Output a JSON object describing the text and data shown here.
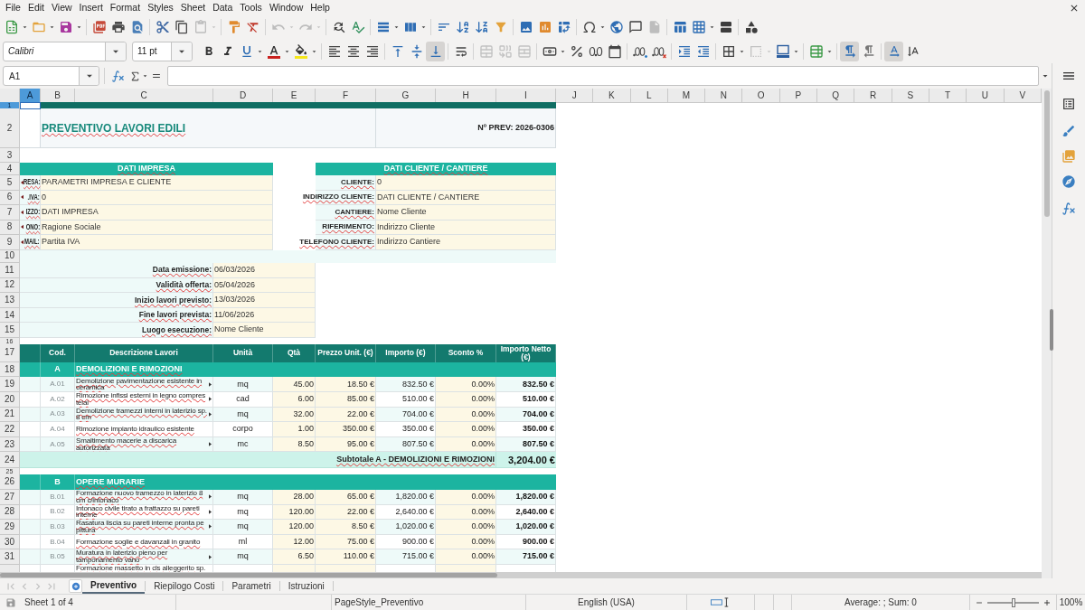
{
  "menu": [
    "File",
    "Edit",
    "View",
    "Insert",
    "Format",
    "Styles",
    "Sheet",
    "Data",
    "Tools",
    "Window",
    "Help"
  ],
  "standard_toolbar": [
    {
      "kind": "new",
      "disabled": false
    },
    {
      "kind": "open",
      "disabled": false
    },
    {
      "kind": "save",
      "disabled": false
    },
    {
      "kind": "export_pdf",
      "disabled": false
    },
    {
      "kind": "print",
      "disabled": false
    },
    {
      "kind": "print_preview",
      "disabled": false
    },
    {
      "kind": "cut",
      "disabled": false
    },
    {
      "kind": "copy",
      "disabled": false
    },
    {
      "kind": "paste",
      "disabled": true
    },
    {
      "kind": "clone_formatting",
      "disabled": false
    },
    {
      "kind": "clear_formatting",
      "disabled": false
    },
    {
      "kind": "undo",
      "disabled": true
    },
    {
      "kind": "redo",
      "disabled": true
    },
    {
      "kind": "find_replace",
      "disabled": false
    },
    {
      "kind": "spelling",
      "disabled": false
    },
    {
      "kind": "rows",
      "disabled": false
    },
    {
      "kind": "columns",
      "disabled": false
    },
    {
      "kind": "sort",
      "disabled": false
    },
    {
      "kind": "sort_ascending",
      "disabled": false
    },
    {
      "kind": "sort_descending",
      "disabled": false
    },
    {
      "kind": "autofilter",
      "disabled": false
    },
    {
      "kind": "image",
      "disabled": false
    },
    {
      "kind": "chart",
      "disabled": false
    },
    {
      "kind": "pivot_table",
      "disabled": false
    },
    {
      "kind": "special_character",
      "disabled": false
    },
    {
      "kind": "hyperlink",
      "disabled": false
    },
    {
      "kind": "comment",
      "disabled": false
    },
    {
      "kind": "header_footer",
      "disabled": true
    },
    {
      "kind": "print_area",
      "disabled": false
    },
    {
      "kind": "freeze",
      "disabled": false
    },
    {
      "kind": "split_window",
      "disabled": false
    },
    {
      "kind": "draw_functions",
      "disabled": false
    }
  ],
  "formatting_toolbar": {
    "font_name": "Calibri",
    "font_size": "11 pt",
    "buttons": [
      {
        "kind": "bold",
        "on": false,
        "disabled": false
      },
      {
        "kind": "italic",
        "on": false,
        "disabled": false
      },
      {
        "kind": "underline",
        "on": false,
        "disabled": false
      },
      {
        "kind": "font_color",
        "on": false,
        "disabled": false
      },
      {
        "kind": "highlight",
        "on": false,
        "disabled": false
      },
      {
        "kind": "align_left",
        "on": false,
        "disabled": false
      },
      {
        "kind": "align_center",
        "on": false,
        "disabled": false
      },
      {
        "kind": "align_right",
        "on": false,
        "disabled": false
      },
      {
        "kind": "align_top",
        "on": false,
        "disabled": false
      },
      {
        "kind": "align_middle",
        "on": false,
        "disabled": false
      },
      {
        "kind": "align_bottom",
        "on": true,
        "disabled": false
      },
      {
        "kind": "wrap",
        "on": false,
        "disabled": false
      },
      {
        "kind": "merge",
        "on": false,
        "disabled": true
      },
      {
        "kind": "merge_center",
        "on": false,
        "disabled": true
      },
      {
        "kind": "unmerge",
        "on": false,
        "disabled": true
      },
      {
        "kind": "currency",
        "on": false,
        "disabled": false
      },
      {
        "kind": "percent",
        "on": false,
        "disabled": false
      },
      {
        "kind": "number",
        "on": false,
        "disabled": false
      },
      {
        "kind": "date",
        "on": false,
        "disabled": false
      },
      {
        "kind": "add_decimal",
        "on": false,
        "disabled": false
      },
      {
        "kind": "delete_decimal",
        "on": false,
        "disabled": false
      },
      {
        "kind": "indent_increase",
        "on": false,
        "disabled": false
      },
      {
        "kind": "indent_decrease",
        "on": false,
        "disabled": false
      },
      {
        "kind": "borders",
        "on": false,
        "disabled": false
      },
      {
        "kind": "border_style",
        "on": false,
        "disabled": true
      },
      {
        "kind": "border_color",
        "on": false,
        "disabled": false
      },
      {
        "kind": "conditional",
        "on": false,
        "disabled": false
      },
      {
        "kind": "ltr",
        "on": true,
        "disabled": false
      },
      {
        "kind": "rtl",
        "on": false,
        "disabled": false
      },
      {
        "kind": "text_horizontal",
        "on": true,
        "disabled": false
      },
      {
        "kind": "text_vertical",
        "on": false,
        "disabled": false
      }
    ]
  },
  "formula_bar": {
    "cell_reference": "A1"
  },
  "column_headers": [
    {
      "label": "A",
      "selected": true
    },
    {
      "label": "B",
      "selected": false
    },
    {
      "label": "C",
      "selected": false
    },
    {
      "label": "D",
      "selected": false
    },
    {
      "label": "E",
      "selected": false
    },
    {
      "label": "F",
      "selected": false
    },
    {
      "label": "G",
      "selected": false
    },
    {
      "label": "H",
      "selected": false
    },
    {
      "label": "I",
      "selected": false
    },
    {
      "label": "J",
      "selected": false
    },
    {
      "label": "K",
      "selected": false
    },
    {
      "label": "L",
      "selected": false
    },
    {
      "label": "M",
      "selected": false
    },
    {
      "label": "N",
      "selected": false
    },
    {
      "label": "O",
      "selected": false
    },
    {
      "label": "P",
      "selected": false
    },
    {
      "label": "Q",
      "selected": false
    },
    {
      "label": "R",
      "selected": false
    },
    {
      "label": "S",
      "selected": false
    },
    {
      "label": "T",
      "selected": false
    },
    {
      "label": "U",
      "selected": false
    },
    {
      "label": "V",
      "selected": false
    }
  ],
  "row_headers": [
    {
      "label": "1",
      "selected": true
    },
    {
      "label": "2",
      "selected": false
    },
    {
      "label": "3",
      "selected": false
    },
    {
      "label": "4",
      "selected": false
    },
    {
      "label": "5",
      "selected": false
    },
    {
      "label": "6",
      "selected": false
    },
    {
      "label": "7",
      "selected": false
    },
    {
      "label": "8",
      "selected": false
    },
    {
      "label": "9",
      "selected": false
    },
    {
      "label": "10",
      "selected": false
    },
    {
      "label": "11",
      "selected": false
    },
    {
      "label": "12",
      "selected": false
    },
    {
      "label": "13",
      "selected": false
    },
    {
      "label": "14",
      "selected": false
    },
    {
      "label": "15",
      "selected": false
    },
    {
      "label": "16",
      "selected": false
    },
    {
      "label": "17",
      "selected": false
    },
    {
      "label": "18",
      "selected": false
    },
    {
      "label": "19",
      "selected": false
    },
    {
      "label": "20",
      "selected": false
    },
    {
      "label": "21",
      "selected": false
    },
    {
      "label": "22",
      "selected": false
    },
    {
      "label": "23",
      "selected": false
    },
    {
      "label": "24",
      "selected": false
    },
    {
      "label": "25",
      "selected": false
    },
    {
      "label": "26",
      "selected": false
    },
    {
      "label": "27",
      "selected": false
    },
    {
      "label": "28",
      "selected": false
    },
    {
      "label": "29",
      "selected": false
    },
    {
      "label": "30",
      "selected": false
    },
    {
      "label": "31",
      "selected": false
    }
  ],
  "sheet": {
    "spelling_marks": true,
    "title": "PREVENTIVO LAVORI EDILI",
    "quote_number": "Nº PREV: 2026-0306",
    "company": {
      "heading": "DATI IMPRESA",
      "fields": [
        {
          "label": "RESA:",
          "value": "PARAMETRI IMPRESA E CLIENTE",
          "overflow": true
        },
        {
          "label": ".IVA:",
          "value": "0",
          "overflow": true
        },
        {
          "label": "IZZO:",
          "value": "DATI IMPRESA",
          "overflow": true
        },
        {
          "label": "ONO:",
          "value": "Ragione Sociale",
          "overflow": true
        },
        {
          "label": "MAIL:",
          "value": "Partita IVA",
          "overflow": true
        }
      ]
    },
    "client": {
      "heading": "DATI CLIENTE / CANTIERE",
      "fields": [
        {
          "label": "CLIENTE:",
          "value": "0",
          "overflow": false
        },
        {
          "label": "INDIRIZZO CLIENTE:",
          "value": "DATI CLIENTE / CANTIERE",
          "overflow": false
        },
        {
          "label": "CANTIERE:",
          "value": "Nome Cliente",
          "overflow": false
        },
        {
          "label": "RIFERIMENTO:",
          "value": "Indirizzo Cliente",
          "overflow": false
        },
        {
          "label": "TELEFONO CLIENTE:",
          "value": "Indirizzo Cantiere",
          "overflow": false
        }
      ]
    },
    "dates": [
      {
        "label": "Data emissione:",
        "value": "06/03/2026"
      },
      {
        "label": "Validità offerta:",
        "value": "05/04/2026"
      },
      {
        "label": "Inizio lavori previsto:",
        "value": "13/03/2026"
      },
      {
        "label": "Fine lavori prevista:",
        "value": "11/06/2026"
      },
      {
        "label": "Luogo esecuzione:",
        "value": "Nome Cliente"
      }
    ],
    "table": {
      "columns": [
        "Cod.",
        "Descrizione Lavori",
        "Unità",
        "Qtà",
        "Prezzo Unit. (€)",
        "Importo (€)",
        "Sconto %",
        "Importo Netto (€)"
      ],
      "sections": [
        {
          "code": "A",
          "title": "DEMOLIZIONI E RIMOZIONI",
          "items": [
            {
              "code": "A.01",
              "description": "Demolizione pavimentazione esistente in ceramica",
              "overflow": true,
              "unit": "mq",
              "qty": "45.00",
              "price": "18.50 €",
              "amount": "832.50 €",
              "discount": "0.00%",
              "net": "832.50 €"
            },
            {
              "code": "A.02",
              "description": "Rimozione infissi esterni in legno compres telai",
              "overflow": true,
              "unit": "cad",
              "qty": "6.00",
              "price": "85.00 €",
              "amount": "510.00 €",
              "discount": "0.00%",
              "net": "510.00 €"
            },
            {
              "code": "A.03",
              "description": "Demolizione tramezzi interni in laterizio sp. 8 cm",
              "overflow": true,
              "unit": "mq",
              "qty": "32.00",
              "price": "22.00 €",
              "amount": "704.00 €",
              "discount": "0.00%",
              "net": "704.00 €"
            },
            {
              "code": "A.04",
              "description": "Rimozione impianto idraulico esistente",
              "overflow": false,
              "unit": "corpo",
              "qty": "1.00",
              "price": "350.00 €",
              "amount": "350.00 €",
              "discount": "0.00%",
              "net": "350.00 €"
            },
            {
              "code": "A.05",
              "description": "Smaltimento macerie a discarica autorizzata",
              "overflow": true,
              "unit": "mc",
              "qty": "8.50",
              "price": "95.00 €",
              "amount": "807.50 €",
              "discount": "0.00%",
              "net": "807.50 €"
            }
          ],
          "subtotal_label": "Subtotale A - DEMOLIZIONI E RIMOZIONI",
          "subtotal": "3,204.00 €"
        },
        {
          "code": "B",
          "title": "OPERE MURARIE",
          "items": [
            {
              "code": "B.01",
              "description": "Formazione nuovo tramezzo in laterizio 8 cm c/intonaco",
              "overflow": true,
              "unit": "mq",
              "qty": "28.00",
              "price": "65.00 €",
              "amount": "1,820.00 €",
              "discount": "0.00%",
              "net": "1,820.00 €"
            },
            {
              "code": "B.02",
              "description": "Intonaco civile tirato a frattazzo su pareti interne",
              "overflow": true,
              "unit": "mq",
              "qty": "120.00",
              "price": "22.00 €",
              "amount": "2,640.00 €",
              "discount": "0.00%",
              "net": "2,640.00 €"
            },
            {
              "code": "B.03",
              "description": "Rasatura liscia su pareti interne pronta pe pittura",
              "overflow": true,
              "unit": "mq",
              "qty": "120.00",
              "price": "8.50 €",
              "amount": "1,020.00 €",
              "discount": "0.00%",
              "net": "1,020.00 €"
            },
            {
              "code": "B.04",
              "description": "Formazione soglie e davanzali in granito",
              "overflow": false,
              "unit": "ml",
              "qty": "12.00",
              "price": "75.00 €",
              "amount": "900.00 €",
              "discount": "0.00%",
              "net": "900.00 €"
            },
            {
              "code": "B.05",
              "description": "Muratura in laterizio pieno per tamponamento vano",
              "overflow": true,
              "unit": "mq",
              "qty": "6.50",
              "price": "110.00 €",
              "amount": "715.00 €",
              "discount": "0.00%",
              "net": "715.00 €"
            },
            {
              "description": "Formazione massetto in cls alleggerito sp.",
              "overflow": false
            }
          ]
        }
      ]
    }
  },
  "sheet_nav": [
    {
      "kind": "first",
      "disabled": true
    },
    {
      "kind": "previous",
      "disabled": true
    },
    {
      "kind": "next",
      "disabled": true
    },
    {
      "kind": "last",
      "disabled": true
    }
  ],
  "sheet_tabs": [
    {
      "label": "Preventivo",
      "selected": true
    },
    {
      "label": "Riepilogo Costi",
      "selected": false
    },
    {
      "label": "Parametri",
      "selected": false
    },
    {
      "label": "Istruzioni",
      "selected": false
    }
  ],
  "status_bar": {
    "sheet_position": "Sheet 1 of 4",
    "page_style": "PageStyle_Preventivo",
    "language": "English (USA)",
    "selection_summary": "Average: ; Sum: 0",
    "zoom": {
      "level": 0.5
    },
    "zoom_percent": "100%"
  }
}
